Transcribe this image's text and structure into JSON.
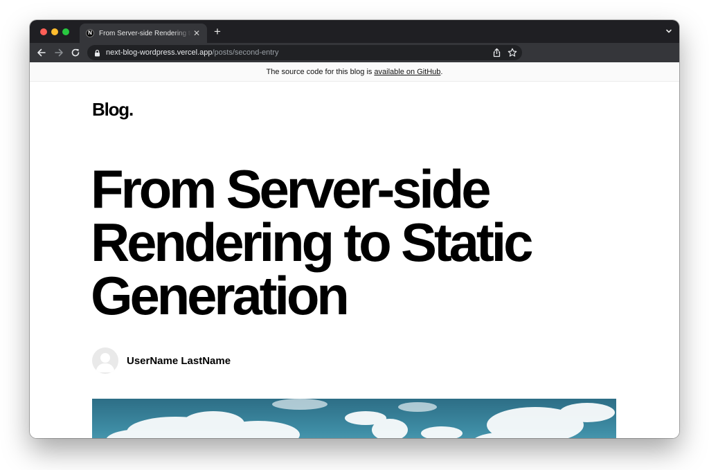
{
  "browser": {
    "tab": {
      "favicon_letter": "N",
      "title": "From Server-side Rendering to Static Generation"
    },
    "address": {
      "host": "next-blog-wordpress.vercel.app",
      "path": "/posts/second-entry"
    },
    "icons": {
      "back": "arrow-left-icon",
      "forward": "arrow-right-icon",
      "reload": "reload-icon",
      "lock": "lock-icon",
      "share": "share-icon",
      "bookmark": "star-icon",
      "tab_close": "close-icon",
      "new_tab": "plus-icon",
      "tab_menu": "chevron-down-icon"
    }
  },
  "page": {
    "banner": {
      "text": "The source code for this blog is",
      "link": "available on GitHub",
      "suffix": "."
    },
    "brand": "Blog.",
    "post": {
      "title": "From Server-side Rendering to Static Generation",
      "author": "UserName LastName"
    }
  },
  "colors": {
    "titlebar": "#1f1f23",
    "toolbar": "#35363a",
    "omnibox": "#202124",
    "text": "#000000"
  }
}
